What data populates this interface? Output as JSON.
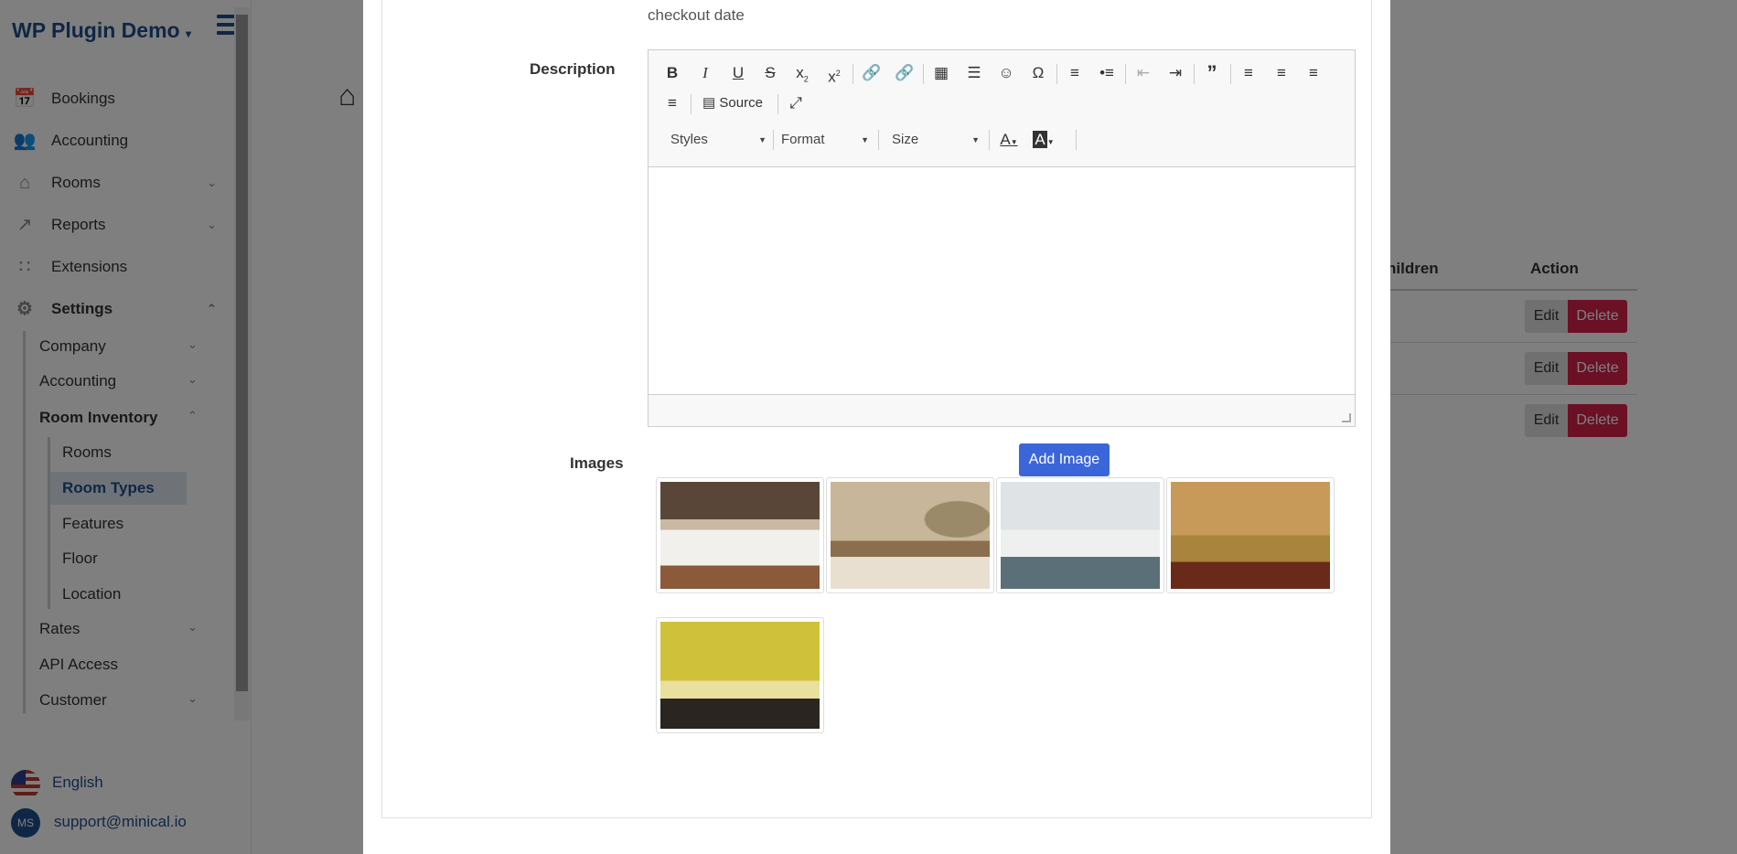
{
  "sidebar": {
    "brand": "WP Plugin Demo",
    "nav": [
      {
        "label": "Bookings",
        "icon": "calendar-icon"
      },
      {
        "label": "Accounting",
        "icon": "users-icon"
      },
      {
        "label": "Rooms",
        "icon": "home-icon"
      },
      {
        "label": "Reports",
        "icon": "chart-icon"
      },
      {
        "label": "Extensions",
        "icon": "grid-icon"
      },
      {
        "label": "Settings",
        "icon": "gear-icon"
      }
    ],
    "settings_sub": [
      "Company",
      "Accounting",
      "Room Inventory",
      "Rates",
      "API Access",
      "Customer"
    ],
    "inventory_sub": [
      "Rooms",
      "Room Types",
      "Features",
      "Floor",
      "Location"
    ],
    "language": "English",
    "avatar_initials": "MS",
    "email": "support@minical.io"
  },
  "background": {
    "col_children": "hildren",
    "col_action": "Action",
    "edit_label": "Edit",
    "delete_label": "Delete"
  },
  "modal": {
    "checkout_text": "checkout date",
    "description_label": "Description",
    "images_label": "Images",
    "add_image_label": "Add Image",
    "editor": {
      "source_label": "Source",
      "styles_label": "Styles",
      "format_label": "Format",
      "size_label": "Size"
    }
  }
}
